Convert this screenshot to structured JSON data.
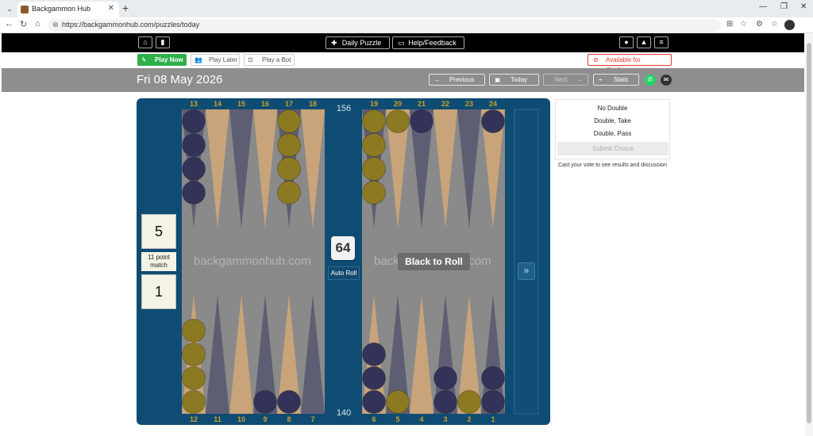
{
  "browser": {
    "tab_title": "Backgammon Hub",
    "url": "https://backgammonhub.com/puzzles/today",
    "new_tab_glyph": "+",
    "close_glyph": "✕",
    "icons": [
      "tab-menu-icon",
      "back-icon",
      "forward-icon",
      "reload-icon",
      "home-icon",
      "lock-icon",
      "reader-icon",
      "favorite-icon",
      "extensions-icon",
      "favorites-bar-icon",
      "profile-icon"
    ]
  },
  "header": {
    "daily_puzzle": "Daily Puzzle",
    "help_feedback": "Help/Feedback"
  },
  "subnav": {
    "play_now": "Play Now",
    "play_later": "Play Later",
    "play_bot": "Play a Bot",
    "challenge": "Available for Challenge"
  },
  "datebar": {
    "date": "Fri 08 May 2026",
    "previous": "Previous",
    "today": "Today",
    "next": "Next",
    "stats": "Stats"
  },
  "board": {
    "top_numbers_left": [
      "13",
      "14",
      "15",
      "16",
      "17",
      "18"
    ],
    "top_numbers_right": [
      "19",
      "20",
      "21",
      "22",
      "23",
      "24"
    ],
    "bottom_numbers_left": [
      "12",
      "11",
      "10",
      "9",
      "8",
      "7"
    ],
    "bottom_numbers_right": [
      "6",
      "5",
      "4",
      "3",
      "2",
      "1"
    ],
    "pip_top": "156",
    "pip_bottom": "140",
    "cube_value": "64",
    "auto_roll": "Auto Roll",
    "status": "Black to Roll",
    "watermark": "backgammonhub.com",
    "score_top": "5",
    "score_bottom": "1",
    "match_line1": "11 point",
    "match_line2": "match",
    "colors": {
      "dark_checker": "#33335a",
      "light_checker": "#8c7a22",
      "light_point": "#c9a47a",
      "dark_point": "#5e5e72",
      "felt": "#8a8a8a",
      "frame": "#0f4c73"
    },
    "checkers": {
      "top": [
        {
          "point": "13",
          "color": "dark",
          "count": 4
        },
        {
          "point": "17",
          "color": "light",
          "count": 4
        },
        {
          "point": "19",
          "color": "light",
          "count": 4
        },
        {
          "point": "20",
          "color": "light",
          "count": 1
        },
        {
          "point": "21",
          "color": "dark",
          "count": 1
        },
        {
          "point": "24",
          "color": "dark",
          "count": 1
        }
      ],
      "bottom": [
        {
          "point": "12",
          "color": "light",
          "count": 4
        },
        {
          "point": "9",
          "color": "dark",
          "count": 1
        },
        {
          "point": "8",
          "color": "dark",
          "count": 1
        },
        {
          "point": "6",
          "color": "dark",
          "count": 3
        },
        {
          "point": "5",
          "color": "light",
          "count": 1
        },
        {
          "point": "3",
          "color": "dark",
          "count": 2
        },
        {
          "point": "2",
          "color": "light",
          "count": 1
        },
        {
          "point": "1",
          "color": "dark",
          "count": 2
        }
      ]
    }
  },
  "panel": {
    "choices": [
      "No Double",
      "Double, Take",
      "Double, Pass"
    ],
    "submit": "Submit Choice",
    "cast": "Cast your vote to see results and discussion"
  }
}
